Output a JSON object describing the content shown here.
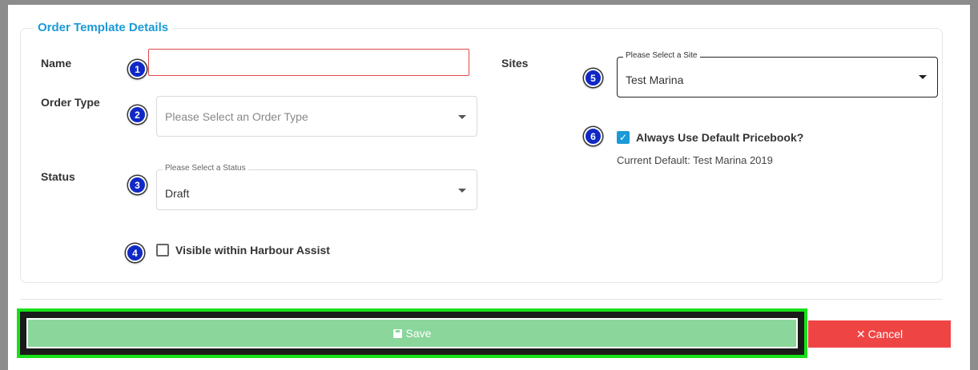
{
  "form": {
    "legend": "Order Template Details",
    "name_label": "Name",
    "name_value": "",
    "order_type_label": "Order Type",
    "order_type_placeholder": "Please Select an Order Type",
    "status_label": "Status",
    "status_float": "Please Select a Status",
    "status_value": "Draft",
    "visible_label": "Visible within Harbour Assist",
    "visible_checked": false,
    "sites_label": "Sites",
    "sites_float": "Please Select a Site",
    "sites_value": "Test Marina",
    "pricebook_label": "Always Use Default Pricebook?",
    "pricebook_checked": true,
    "current_default": "Current Default: Test Marina 2019"
  },
  "badges": [
    "1",
    "2",
    "3",
    "4",
    "5",
    "6"
  ],
  "buttons": {
    "save_label": "Save",
    "save_icon": "floppy-disk-icon",
    "cancel_label": "Cancel",
    "cancel_icon": "times-icon"
  },
  "colors": {
    "accent": "#1a9ad6",
    "save": "#8ad69b",
    "cancel": "#ef4444",
    "highlight": "#18e018",
    "badge": "#1028c6",
    "error_border": "#e0484a"
  }
}
